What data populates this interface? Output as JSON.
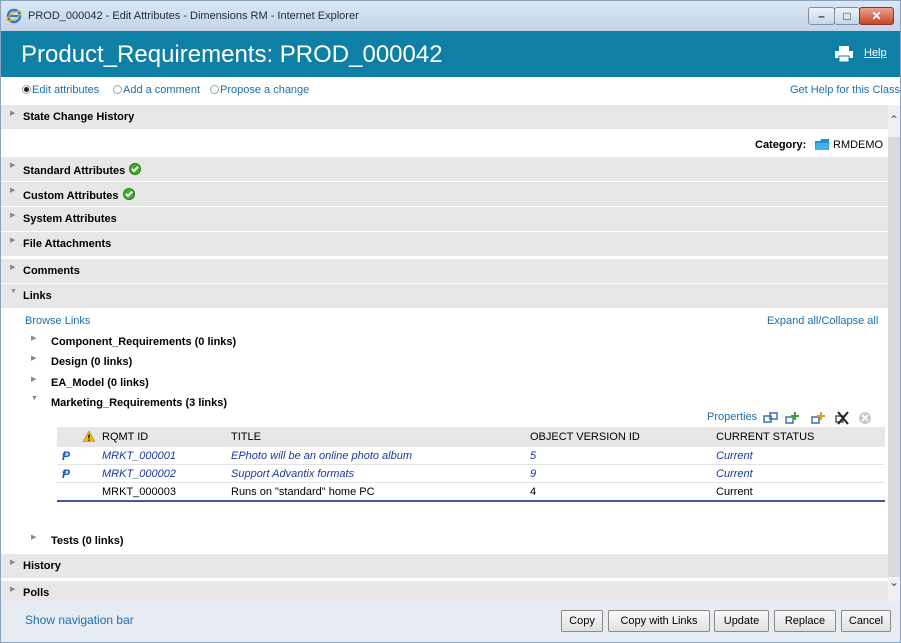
{
  "window": {
    "title": "PROD_000042 - Edit Attributes - Dimensions RM - Internet Explorer",
    "minimize_glyph": "–",
    "maximize_glyph": "□",
    "close_glyph": "✕"
  },
  "header": {
    "title": "Product_Requirements: PROD_000042",
    "help_label": "Help",
    "bg_color": "#0f80a5"
  },
  "modes": {
    "options": [
      "Edit attributes",
      "Add a comment",
      "Propose a change"
    ],
    "selected": "Edit attributes",
    "get_help": "Get Help for this Class"
  },
  "sections": {
    "state_change_history": "State Change History",
    "standard_attributes": "Standard Attributes",
    "custom_attributes": "Custom Attributes",
    "system_attributes": "System Attributes",
    "file_attachments": "File Attachments",
    "comments": "Comments",
    "links": "Links",
    "history": "History",
    "polls": "Polls"
  },
  "category": {
    "label": "Category:",
    "value": "RMDEMO"
  },
  "links": {
    "browse": "Browse Links",
    "expand_all": "Expand all",
    "separator": "/",
    "collapse_all": "Collapse all",
    "groups": [
      "Component_Requirements (0 links)",
      "Design (0 links)",
      "EA_Model (0 links)",
      "Marketing_Requirements (3 links)",
      "Tests (0 links)"
    ],
    "properties_label": "Properties",
    "table": {
      "headers": [
        "RQMT ID",
        "TITLE",
        "OBJECT VERSION ID",
        "CURRENT STATUS"
      ],
      "rows": [
        {
          "id": "MRKT_000001",
          "title": "EPhoto will be an online photo album",
          "version": "5",
          "status": "Current",
          "linked": true
        },
        {
          "id": "MRKT_000002",
          "title": "Support Advantix formats",
          "version": "9",
          "status": "Current",
          "linked": true
        },
        {
          "id": "MRKT_000003",
          "title": "Runs on \"standard\" home PC",
          "version": "4",
          "status": "Current",
          "linked": false
        }
      ]
    }
  },
  "footer": {
    "show_nav": "Show navigation bar",
    "buttons": {
      "copy": "Copy",
      "copy_with_links": "Copy with Links",
      "update": "Update",
      "replace": "Replace",
      "cancel": "Cancel"
    }
  },
  "icons": {
    "window": "ie-icon",
    "print": "printer-icon",
    "category": "folder-icon",
    "valid": "check-circle-icon",
    "warning": "warning-icon",
    "link": "link-icon",
    "properties_tools": [
      "link-objects-icon",
      "add-link-icon",
      "add-link-alt-icon",
      "remove-link-icon",
      "delete-icon"
    ]
  }
}
